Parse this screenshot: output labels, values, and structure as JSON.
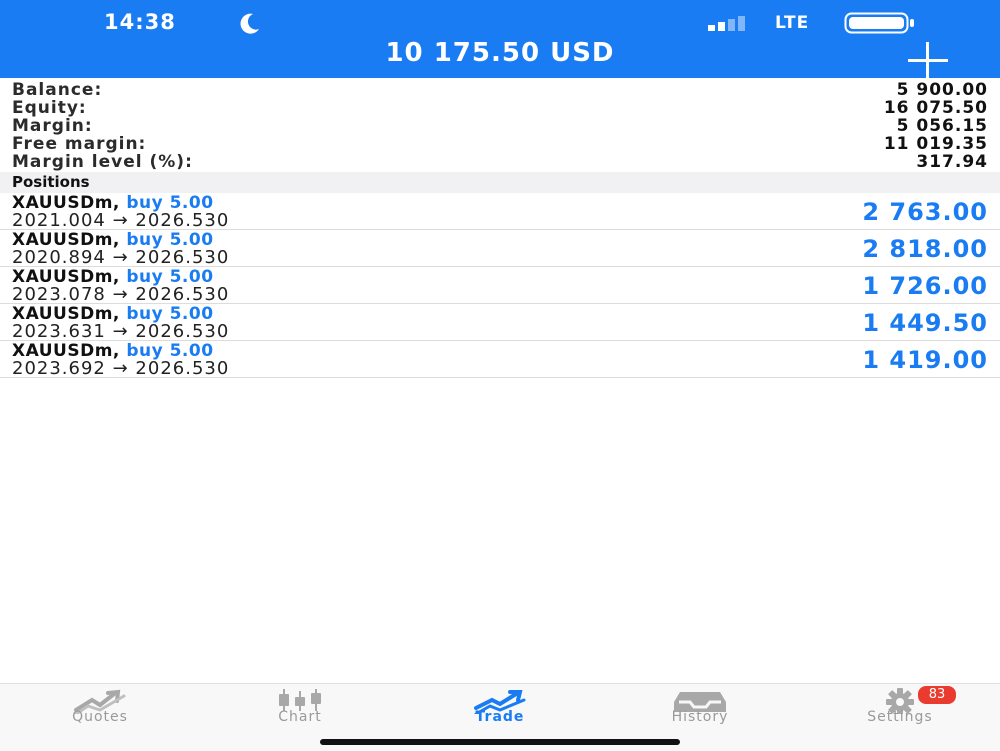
{
  "status_bar": {
    "time": "14:38",
    "network": "LTE",
    "icons": [
      "moon-icon",
      "signal-icon",
      "battery-icon"
    ]
  },
  "header": {
    "title": "10 175.50 USD",
    "add_icon": "plus-icon",
    "background_color": "#1a7cf2"
  },
  "summary": [
    {
      "label": "Balance:",
      "value": "5 900.00"
    },
    {
      "label": "Equity:",
      "value": "16 075.50"
    },
    {
      "label": "Margin:",
      "value": "5 056.15"
    },
    {
      "label": "Free margin:",
      "value": "11 019.35"
    },
    {
      "label": "Margin level (%):",
      "value": "317.94"
    }
  ],
  "positions": {
    "title": "Positions",
    "items": [
      {
        "symbol": "XAUUSDm,",
        "direction": "buy 5.00",
        "prices": "2021.004 → 2026.530",
        "profit": "2 763.00"
      },
      {
        "symbol": "XAUUSDm,",
        "direction": "buy 5.00",
        "prices": "2020.894 → 2026.530",
        "profit": "2 818.00"
      },
      {
        "symbol": "XAUUSDm,",
        "direction": "buy 5.00",
        "prices": "2023.078 → 2026.530",
        "profit": "1 726.00"
      },
      {
        "symbol": "XAUUSDm,",
        "direction": "buy 5.00",
        "prices": "2023.631 → 2026.530",
        "profit": "1 449.50"
      },
      {
        "symbol": "XAUUSDm,",
        "direction": "buy 5.00",
        "prices": "2023.692 → 2026.530",
        "profit": "1 419.00"
      }
    ]
  },
  "tabbar": {
    "tabs": [
      {
        "label": "Quotes",
        "icon": "quotes-icon"
      },
      {
        "label": "Chart",
        "icon": "candlestick-icon"
      },
      {
        "label": "Trade",
        "icon": "trade-icon",
        "active": true
      },
      {
        "label": "History",
        "icon": "inbox-icon"
      },
      {
        "label": "Settings",
        "icon": "gear-icon"
      }
    ],
    "settings_badge": "83",
    "active_color": "#1a7cf2",
    "badge_color": "#ea3b2f"
  }
}
